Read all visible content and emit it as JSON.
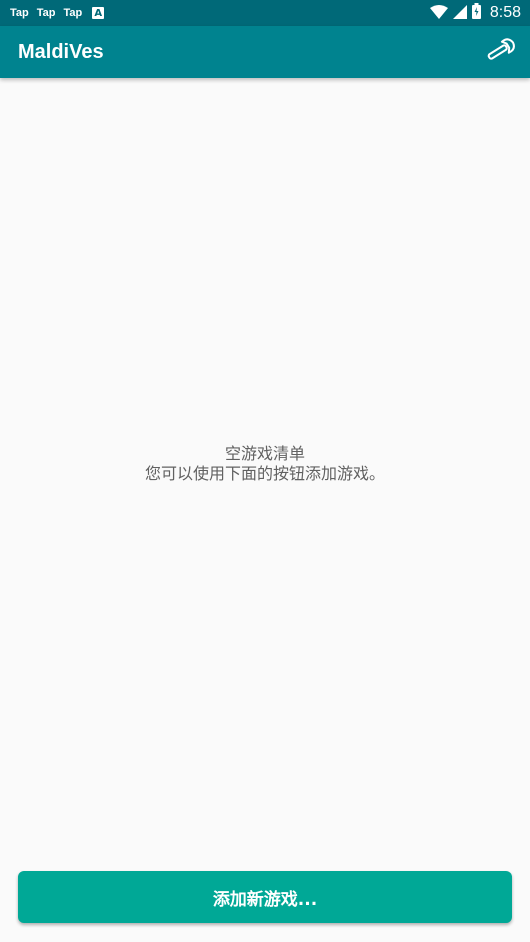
{
  "status_bar": {
    "notifications": [
      "Tap",
      "Tap",
      "Tap"
    ],
    "notification_extra": "A",
    "time": "8:58",
    "icons": [
      "wifi-icon",
      "signal-icon",
      "battery-icon"
    ]
  },
  "app_bar": {
    "title": "MaldiVes",
    "settings_icon": "wrench-icon"
  },
  "empty_state": {
    "title": "空游戏清单",
    "message": "您可以使用下面的按钮添加游戏。"
  },
  "footer": {
    "add_button_label": "添加新游戏..."
  },
  "colors": {
    "status_bar": "#006978",
    "app_bar": "#00838f",
    "background": "#fafafa",
    "button": "#00a896",
    "text_secondary": "#616161"
  }
}
